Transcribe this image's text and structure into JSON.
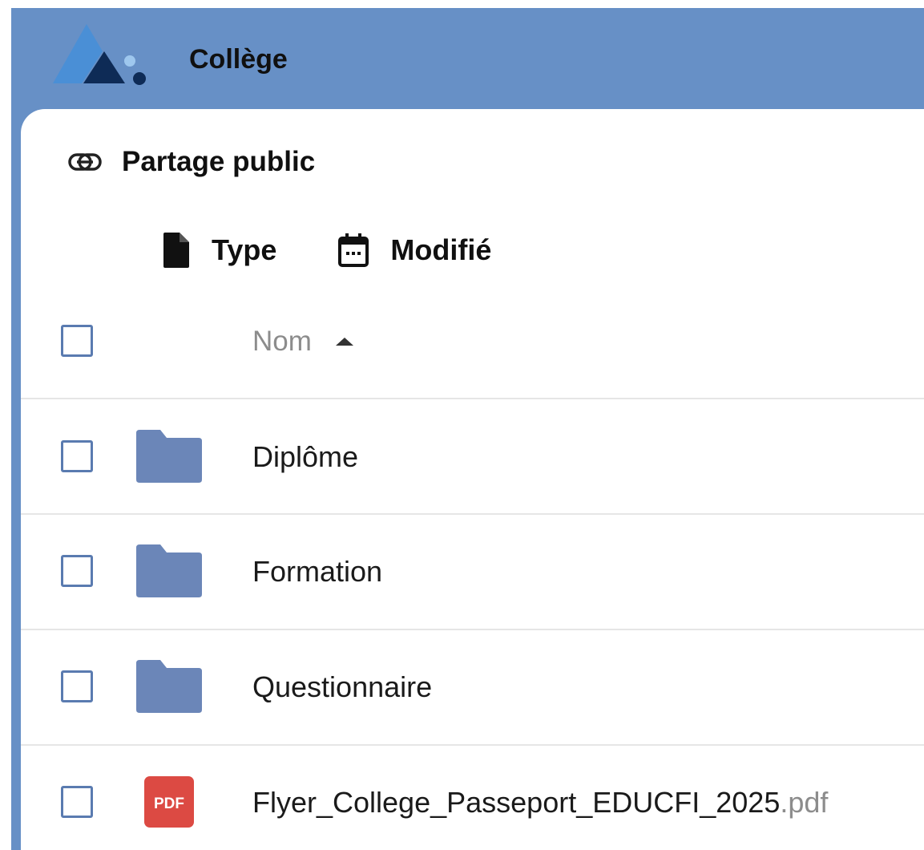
{
  "app": {
    "title": "Collège"
  },
  "share": {
    "label": "Partage public",
    "icon": "link-icon"
  },
  "filters": [
    {
      "label": "Type",
      "icon": "file-icon"
    },
    {
      "label": "Modifié",
      "icon": "calendar-icon"
    }
  ],
  "table": {
    "column_name": "Nom",
    "sort_direction": "ascending",
    "rows": [
      {
        "name": "Diplôme",
        "ext": "",
        "type": "folder",
        "icon": "folder-icon"
      },
      {
        "name": "Formation",
        "ext": "",
        "type": "folder",
        "icon": "folder-icon"
      },
      {
        "name": "Questionnaire",
        "ext": "",
        "type": "folder",
        "icon": "folder-icon"
      },
      {
        "name": "Flyer_College_Passeport_EDUCFI_2025",
        "ext": ".pdf",
        "type": "pdf",
        "icon": "pdf-icon",
        "icon_text": "PDF"
      }
    ]
  },
  "colors": {
    "header_bg": "#6790c6",
    "folder": "#6b86b8",
    "pdf": "#dc4a43",
    "checkbox_border": "#5a7bb0"
  }
}
